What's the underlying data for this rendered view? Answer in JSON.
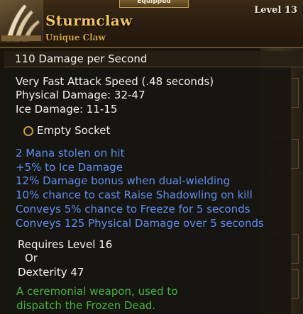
{
  "header": {
    "equipped_label": "Equipped",
    "item_name": "Sturmclaw",
    "item_type": "Unique Claw",
    "level": "Level 13"
  },
  "stats": {
    "dps": "110  Damage per Second",
    "attack_speed": "Very Fast Attack Speed (.48 seconds)",
    "physical_damage": "Physical Damage: 32-47",
    "ice_damage": "Ice Damage: 11-15"
  },
  "socket": {
    "label": "Empty Socket"
  },
  "modifiers": [
    "2 Mana stolen on hit",
    "+5% to Ice Damage",
    "12% Damage bonus when dual-wielding",
    "10% chance to cast Raise Shadowling on kill",
    "Conveys 5% chance to Freeze for 5 seconds",
    "Conveys 125 Physical Damage over 5 seconds"
  ],
  "requirements": {
    "level": "Requires Level 16",
    "or": "Or",
    "dexterity": "Dexterity 47"
  },
  "flavor": {
    "line1": "A ceremonial weapon, used to",
    "line2": "dispatch the Frozen Dead."
  },
  "colors": {
    "name": "#f4c55a",
    "type": "#d2a33e",
    "modifier": "#5d8ef5",
    "flavor": "#3fb63f"
  },
  "icons": {
    "item": "claw-weapon-icon",
    "socket": "socket-ring-icon"
  }
}
